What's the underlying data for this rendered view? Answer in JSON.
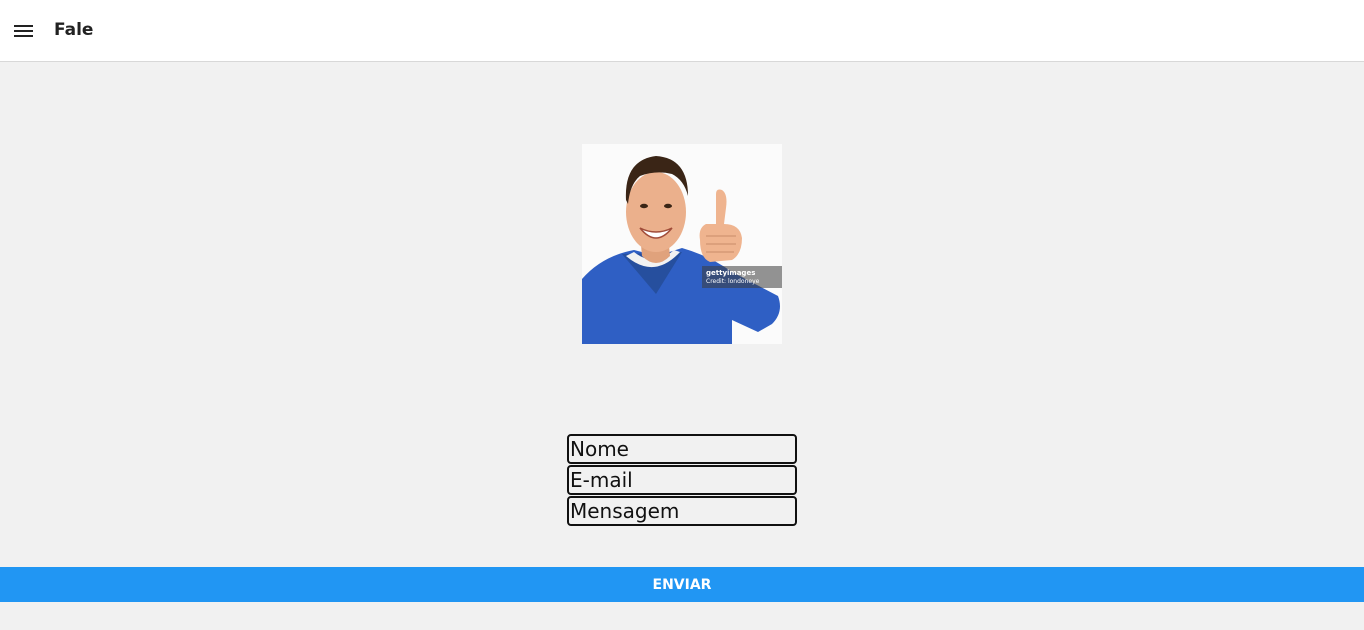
{
  "header": {
    "title": "Fale",
    "menu_icon": "hamburger-menu-icon"
  },
  "photo": {
    "description_icon": "person-thumbs-up-photo",
    "watermark_brand": "gettyimages",
    "watermark_credit": "Credit: londoneye"
  },
  "form": {
    "name_placeholder": "Nome",
    "email_placeholder": "E-mail",
    "message_placeholder": "Mensagem"
  },
  "actions": {
    "send_label": "ENVIAR"
  },
  "colors": {
    "accent": "#2196f3",
    "background": "#f1f1f1",
    "header": "#ffffff"
  }
}
